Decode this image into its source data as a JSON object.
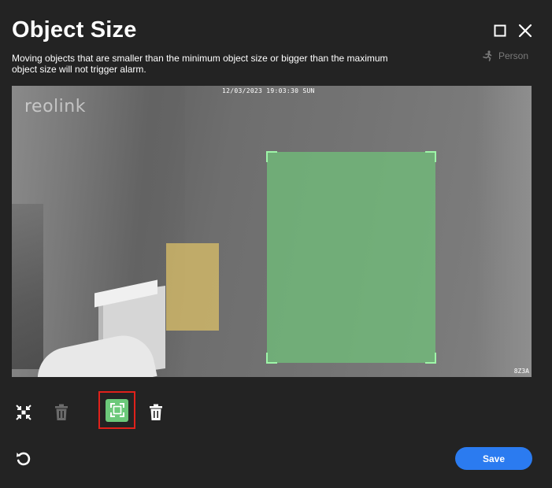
{
  "dialog": {
    "title": "Object Size",
    "description": "Moving objects that are smaller than the minimum object size or bigger than the maximum object size will not trigger alarm.",
    "person_label": "Person"
  },
  "video": {
    "timestamp": "12/03/2023 19:03:30 SUN",
    "brand": "reolink",
    "channel": "8Z3A"
  },
  "toolbar": {
    "min_size_icon": "minimum-size-icon",
    "min_delete_icon": "trash-icon",
    "max_size_icon": "maximum-size-icon",
    "max_delete_icon": "trash-icon",
    "selected_tool": "maximum-size"
  },
  "footer": {
    "reset_icon": "reset-icon",
    "save_label": "Save"
  },
  "colors": {
    "background": "#232323",
    "accent": "#2b7bf0",
    "min_box": "#e0c468",
    "max_box": "#70c47a",
    "selection_outline": "#e0211b"
  }
}
